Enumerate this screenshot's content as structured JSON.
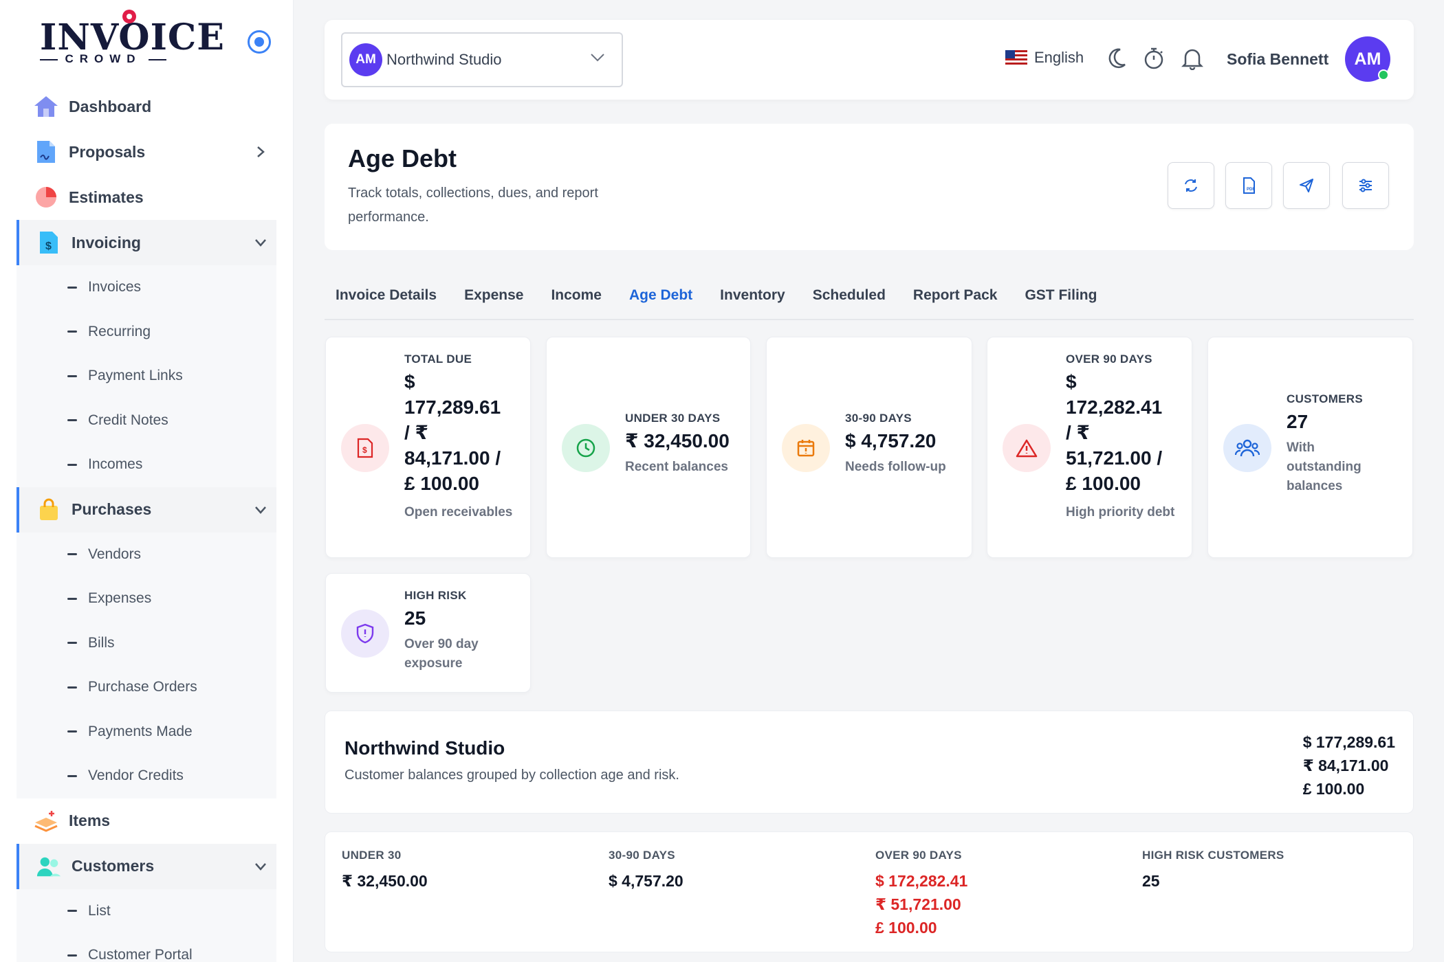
{
  "brand": {
    "logo_main": "INVOICE",
    "logo_sub": "CROWD"
  },
  "sidebar": {
    "items": [
      {
        "label": "Dashboard"
      },
      {
        "label": "Proposals"
      },
      {
        "label": "Estimates"
      },
      {
        "label": "Invoicing"
      },
      {
        "label": "Purchases"
      },
      {
        "label": "Items"
      },
      {
        "label": "Customers"
      }
    ],
    "invoicing_sub": [
      "Invoices",
      "Recurring",
      "Payment Links",
      "Credit Notes",
      "Incomes"
    ],
    "purchases_sub": [
      "Vendors",
      "Expenses",
      "Bills",
      "Purchase Orders",
      "Payments Made",
      "Vendor Credits"
    ],
    "customers_sub": [
      "List",
      "Customer Portal"
    ]
  },
  "topbar": {
    "org_initials": "AM",
    "org_name": "Northwind Studio",
    "language": "English",
    "user_name": "Sofia Bennett",
    "user_initials": "AM"
  },
  "header": {
    "title": "Age Debt",
    "subtitle": "Track totals, collections, dues, and report performance."
  },
  "tabs": [
    "Invoice Details",
    "Expense",
    "Income",
    "Age Debt",
    "Inventory",
    "Scheduled",
    "Report Pack",
    "GST Filing"
  ],
  "stats": [
    {
      "label": "TOTAL DUE",
      "value_lines": [
        "$",
        "177,289.61",
        "/ ₹",
        "84,171.00 /",
        "£ 100.00"
      ],
      "note": "Open receivables"
    },
    {
      "label": "UNDER 30 DAYS",
      "value_lines": [
        "₹ 32,450.00"
      ],
      "note": "Recent balances"
    },
    {
      "label": "30-90 DAYS",
      "value_lines": [
        "$ 4,757.20"
      ],
      "note": "Needs follow-up"
    },
    {
      "label": "OVER 90 DAYS",
      "value_lines": [
        "$",
        "172,282.41",
        "/ ₹",
        "51,721.00 /",
        "£ 100.00"
      ],
      "note": "High priority debt"
    },
    {
      "label": "CUSTOMERS",
      "value_lines": [
        "27"
      ],
      "note": "With outstanding balances"
    },
    {
      "label": "HIGH RISK",
      "value_lines": [
        "25"
      ],
      "note": "Over 90 day exposure"
    }
  ],
  "org_summary": {
    "title": "Northwind Studio",
    "description": "Customer balances grouped by collection age and risk.",
    "totals": [
      "$ 177,289.61",
      "₹ 84,171.00",
      "£ 100.00"
    ]
  },
  "buckets": [
    {
      "label": "UNDER 30",
      "values": [
        "₹ 32,450.00"
      ]
    },
    {
      "label": "30-90 DAYS",
      "values": [
        "$ 4,757.20"
      ]
    },
    {
      "label": "OVER 90 DAYS",
      "values": [
        "$ 172,282.41",
        "₹ 51,721.00",
        "£ 100.00"
      ]
    },
    {
      "label": "HIGH RISK CUSTOMERS",
      "values": [
        "25"
      ]
    }
  ],
  "colors": {
    "accent": "#1d64d8",
    "avatar": "#5b3cf0",
    "danger": "#dc2626",
    "online": "#22c55e"
  }
}
